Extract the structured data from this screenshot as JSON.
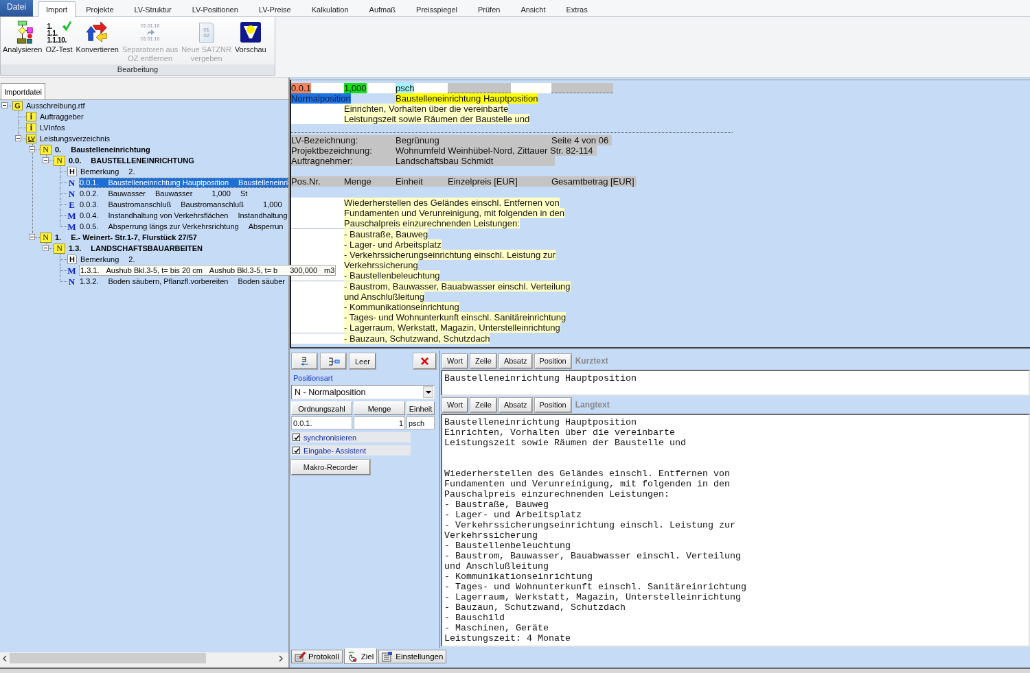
{
  "menu_tabs": [
    {
      "label": "Datei",
      "kind": "file",
      "selected": false
    },
    {
      "label": "Import",
      "kind": "tab",
      "selected": true
    },
    {
      "label": "Projekte",
      "kind": "tab",
      "selected": false
    },
    {
      "label": "LV-Struktur",
      "kind": "tab",
      "selected": false
    },
    {
      "label": "LV-Positionen",
      "kind": "tab",
      "selected": false
    },
    {
      "label": "LV-Preise",
      "kind": "tab",
      "selected": false
    },
    {
      "label": "Kalkulation",
      "kind": "tab",
      "selected": false
    },
    {
      "label": "Aufmaß",
      "kind": "tab",
      "selected": false
    },
    {
      "label": "Preisspiegel",
      "kind": "tab",
      "selected": false
    },
    {
      "label": "Prüfen",
      "kind": "tab",
      "selected": false
    },
    {
      "label": "Ansicht",
      "kind": "tab",
      "selected": false
    },
    {
      "label": "Extras",
      "kind": "tab",
      "selected": false
    }
  ],
  "ribbon": {
    "groups": [
      {
        "label": "Bearbeitung",
        "buttons": [
          {
            "label": "Analysieren",
            "kind": "flowchart",
            "disabled": false
          },
          {
            "label": "OZ-Test",
            "kind": "numbering",
            "icon_text": [
              "1.",
              "1.1.",
              "1.1.10."
            ],
            "disabled": false
          },
          {
            "label": "Konvertieren",
            "kind": "convert",
            "disabled": false
          },
          {
            "label": "Separatoren aus\nOZ entfernen",
            "kind": "separators",
            "icon_text": [
              "01.01.10",
              "01 01 10"
            ],
            "disabled": true
          },
          {
            "label": "Neue SATZNR\nvergeben",
            "kind": "renumber",
            "icon_text": [
              "01",
              "02"
            ],
            "disabled": true
          },
          {
            "label": "Vorschau",
            "kind": "preview",
            "disabled": false
          }
        ]
      }
    ]
  },
  "tree": {
    "tabs": [
      {
        "label": "Importdatei",
        "selected": true
      }
    ],
    "nodes": [
      {
        "kind": "root",
        "badge": "G",
        "cells": [
          "Ausschreibung.rtf"
        ],
        "expanded": true,
        "selected": false,
        "children": [
          {
            "kind": "info",
            "badge": "i",
            "cells": [
              "Auftraggeber"
            ],
            "selected": false
          },
          {
            "kind": "info",
            "badge": "i",
            "cells": [
              "LVInfos"
            ],
            "selected": false
          },
          {
            "kind": "lv",
            "badge": "LV",
            "cells": [
              "Leistungsverzeichnis"
            ],
            "expanded": true,
            "selected": false,
            "children": [
              {
                "kind": "title",
                "badge": "N",
                "cells": [
                  "0.",
                  "Baustelleneinrichtung"
                ],
                "expanded": true,
                "selected": false,
                "children": [
                  {
                    "kind": "title",
                    "badge": "N",
                    "cells": [
                      "0.0.",
                      "BAUSTELLENEINRICHTUNG"
                    ],
                    "expanded": true,
                    "selected": false,
                    "children": [
                      {
                        "kind": "note",
                        "badge": "H",
                        "cells": [
                          "Bemerkung",
                          "2."
                        ],
                        "selected": false,
                        "hovered": false
                      },
                      {
                        "kind": "position",
                        "badge": "N",
                        "cells": [
                          "0.0.1.",
                          "Baustelleneinrichtung Hauptposition",
                          "Baustelleneinri"
                        ],
                        "selected": true,
                        "hovered": false
                      },
                      {
                        "kind": "position",
                        "badge": "N",
                        "cells": [
                          "0.0.2.",
                          "Bauwasser",
                          "Bauwasser",
                          "1,000",
                          "St"
                        ],
                        "selected": false,
                        "hovered": false
                      },
                      {
                        "kind": "position",
                        "badge": "E",
                        "cells": [
                          "0.0.3.",
                          "Baustromanschluß",
                          "Baustromanschluß",
                          "1,000"
                        ],
                        "selected": false,
                        "hovered": false
                      },
                      {
                        "kind": "position",
                        "badge": "M",
                        "cells": [
                          "0.0.4.",
                          "Instandhaltung von Verkehrsflächen",
                          "Instandhaltung"
                        ],
                        "selected": false,
                        "hovered": false
                      },
                      {
                        "kind": "position",
                        "badge": "M",
                        "cells": [
                          "0.0.5.",
                          "Absperrung längs zur Verkehrsrichtung",
                          "Absperrun"
                        ],
                        "selected": false,
                        "hovered": false
                      }
                    ]
                  }
                ]
              },
              {
                "kind": "title",
                "badge": "N",
                "cells": [
                  "1.",
                  "E.- Weinert- Str.1-7, Flurstück 27/57"
                ],
                "expanded": true,
                "selected": false,
                "children": [
                  {
                    "kind": "title",
                    "badge": "N",
                    "cells": [
                      "1.3.",
                      "LANDSCHAFTSBAUARBEITEN"
                    ],
                    "expanded": true,
                    "selected": false,
                    "children": [
                      {
                        "kind": "note",
                        "badge": "H",
                        "cells": [
                          "Bemerkung",
                          "2."
                        ],
                        "selected": false,
                        "hovered": false
                      },
                      {
                        "kind": "position",
                        "badge": "M",
                        "cells": [
                          "1.3.1.",
                          "Aushub Bkl.3-5, t= bis 20 cm",
                          "Aushub Bkl.3-5, t= b",
                          "300,000",
                          "m3"
                        ],
                        "selected": false,
                        "hovered": true
                      },
                      {
                        "kind": "position",
                        "badge": "N",
                        "cells": [
                          "1.3.2.",
                          "Boden säubern, Pflanzfl.vorbereiten",
                          "Boden säuber"
                        ],
                        "selected": false,
                        "hovered": false
                      }
                    ]
                  }
                ]
              }
            ]
          }
        ]
      }
    ]
  },
  "preview": {
    "position": {
      "number": "0.0.1",
      "quantity": "1,000",
      "unit": "psch",
      "type": "Normalposition",
      "short_text": "Baustelleneinrichtung Hauptposition",
      "long_text": [
        "Einrichten, Vorhalten über die vereinbarte",
        "Leistungszeit sowie Räumen der Baustelle und"
      ]
    },
    "header": [
      {
        "label": "LV-Bezeichnung:",
        "value": "Begrünung",
        "extra": "Seite 4 von 06"
      },
      {
        "label": "Projektbezeichnung:",
        "value": "Wohnumfeld Weinhübel-Nord, Zittauer Str. 82-114"
      },
      {
        "label": "Auftragnehmer:",
        "value": "Landschaftsbau Schmidt"
      }
    ],
    "columns": [
      "Pos.Nr.",
      "Menge",
      "Einheit",
      "Einzelpreis [EUR]",
      "Gesamtbetrag [EUR]"
    ],
    "blocks": [
      [
        "Wiederherstellen des Geländes einschl. Entfernen von",
        "Fundamenten und Verunreinigung, mit folgenden in den",
        "Pauschalpreis einzurechnenden Leistungen:"
      ],
      [
        "- Baustraße, Bauweg",
        "- Lager- und Arbeitsplatz",
        "- Verkehrssicherungseinrichtung einschl. Leistung zur",
        "Verkehrssicherung",
        "- Baustellenbeleuchtung"
      ],
      [
        "- Baustrom, Bauwasser, Bauabwasser einschl. Verteilung",
        "und Anschlußleitung",
        "- Kommunikationseinrichtung",
        "- Tages- und Wohnunterkunft einschl. Sanitäreinrichtung",
        "- Lagerraum, Werkstatt, Magazin, Unterstelleinrichtung"
      ],
      [
        "- Bauzaun, Schutzwand, Schutzdach"
      ]
    ]
  },
  "editor": {
    "toolbar": [
      {
        "kind": "lines-arrow"
      },
      {
        "kind": "lines-box"
      },
      {
        "kind": "text",
        "label": "Leer"
      },
      {
        "kind": "delete"
      }
    ],
    "position_type": {
      "label": "Positionsart",
      "value": "N - Normalposition"
    },
    "grid": {
      "columns": [
        "Ordnungszahl",
        "Menge",
        "Einheit"
      ],
      "values": [
        "0.0.1.",
        "1",
        "psch"
      ]
    },
    "options": [
      {
        "label": "synchronisieren",
        "checked": true
      },
      {
        "label": "Eingabe- Assistent",
        "checked": true
      }
    ],
    "macro_button": "Makro-Recorder",
    "sections": [
      {
        "label": "Kurztext",
        "tools": [
          "Wort",
          "Zeile",
          "Absatz",
          "Position"
        ],
        "paragraphs": [
          [
            "Baustelleneinrichtung Hauptposition"
          ]
        ]
      },
      {
        "label": "Langtext",
        "tools": [
          "Wort",
          "Zeile",
          "Absatz",
          "Position"
        ],
        "paragraphs": [
          [
            "Baustelleneinrichtung Hauptposition",
            "Einrichten, Vorhalten über die vereinbarte",
            "Leistungszeit sowie Räumen der Baustelle und"
          ],
          [
            "Wiederherstellen des Geländes einschl. Entfernen von",
            "Fundamenten und Verunreinigung, mit folgenden in den",
            "Pauschalpreis einzurechnenden Leistungen:",
            "- Baustraße, Bauweg",
            "- Lager- und Arbeitsplatz",
            "- Verkehrssicherungseinrichtung einschl. Leistung zur",
            "Verkehrssicherung",
            "- Baustellenbeleuchtung",
            "- Baustrom, Bauwasser, Bauabwasser einschl. Verteilung",
            "und Anschlußleitung",
            "- Kommunikationseinrichtung",
            "- Tages- und Wohnunterkunft einschl. Sanitäreinrichtung",
            "- Lagerraum, Werkstatt, Magazin, Unterstelleinrichtung",
            "- Bauzaun, Schutzwand, Schutzdach",
            "- Bauschild",
            "- Maschinen, Geräte",
            "Leistungszeit: 4 Monate"
          ]
        ]
      }
    ],
    "bottom_tabs": [
      {
        "label": "Protokoll",
        "kind": "log",
        "selected": false
      },
      {
        "label": "Ziel",
        "kind": "target",
        "selected": true
      },
      {
        "label": "Einstellungen",
        "kind": "settings",
        "selected": false
      }
    ]
  }
}
